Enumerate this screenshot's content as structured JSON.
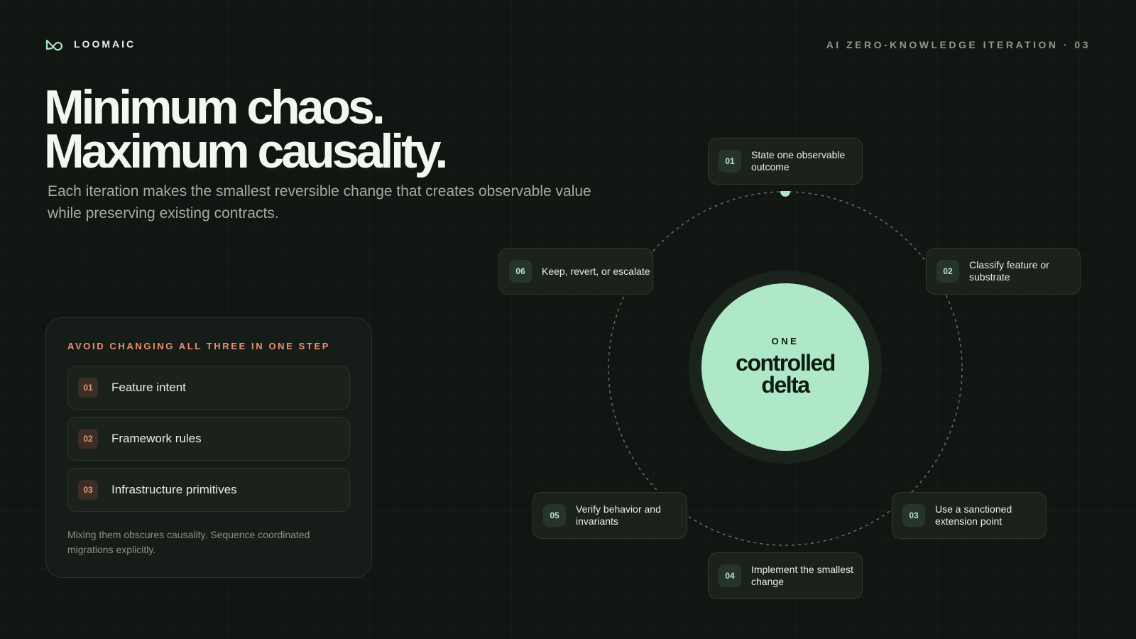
{
  "brand": {
    "name": "LOOMAIC",
    "logo_icon": "loop-infinity-icon",
    "accent": "#a9e4c0"
  },
  "header": {
    "kicker": "AI ZERO-KNOWLEDGE ITERATION · 03"
  },
  "hero": {
    "title_line1": "Minimum chaos.",
    "title_line2": "Maximum causality.",
    "subtitle": "Each iteration makes the smallest reversible change that creates observable value while preserving existing contracts."
  },
  "avoid": {
    "heading": "AVOID CHANGING ALL THREE IN ONE STEP",
    "items": [
      {
        "num": "01",
        "label": "Feature intent"
      },
      {
        "num": "02",
        "label": "Framework rules"
      },
      {
        "num": "03",
        "label": "Infrastructure primitives"
      }
    ],
    "note": "Mixing them obscures causality. Sequence coordinated migrations explicitly.",
    "accent": "#ef8f70"
  },
  "cycle": {
    "center_kicker": "ONE",
    "center_line1": "controlled",
    "center_line2": "delta",
    "center_color": "#aee8c6",
    "steps": [
      {
        "num": "01",
        "label": "State one observable outcome"
      },
      {
        "num": "02",
        "label": "Classify feature or substrate"
      },
      {
        "num": "03",
        "label": "Use a sanctioned extension point"
      },
      {
        "num": "04",
        "label": "Implement the smallest change"
      },
      {
        "num": "05",
        "label": "Verify behavior and invariants"
      },
      {
        "num": "06",
        "label": "Keep, revert, or escalate"
      }
    ]
  }
}
